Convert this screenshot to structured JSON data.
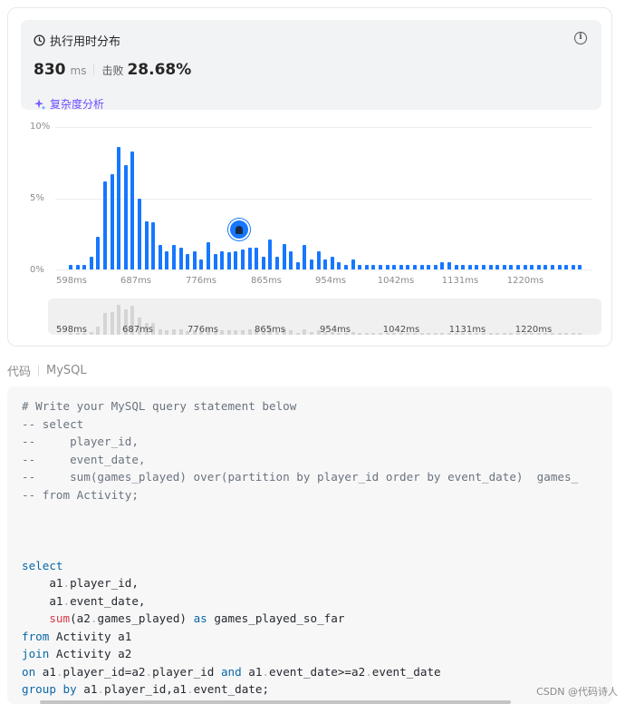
{
  "runtime": {
    "title": "执行用时分布",
    "value": "830",
    "unit": "ms",
    "beat_label": "击败",
    "beat_value": "28.68%",
    "complexity_link": "复杂度分析",
    "info_icon": "i"
  },
  "chart_data": {
    "type": "bar",
    "ylabel": "",
    "xlabel": "",
    "y_ticks": [
      "10%",
      "5%",
      "0%"
    ],
    "ylim": [
      0,
      10
    ],
    "x_ticks": [
      "598ms",
      "687ms",
      "776ms",
      "865ms",
      "954ms",
      "1042ms",
      "1131ms",
      "1220ms"
    ],
    "values": [
      0.3,
      0.3,
      0.3,
      0.9,
      2.3,
      6.2,
      6.7,
      8.6,
      7.3,
      8.3,
      5.0,
      3.4,
      3.3,
      1.7,
      1.3,
      1.7,
      1.5,
      1.1,
      1.3,
      0.7,
      1.9,
      1.1,
      1.3,
      1.2,
      1.3,
      1.4,
      1.5,
      1.5,
      0.9,
      2.1,
      0.9,
      1.8,
      1.3,
      0.5,
      1.7,
      0.7,
      1.3,
      0.7,
      0.9,
      0.5,
      0.3,
      0.7,
      0.3,
      0.3,
      0.3,
      0.3,
      0.3,
      0.3,
      0.3,
      0.3,
      0.3,
      0.3,
      0.3,
      0.3,
      0.5,
      0.5,
      0.3,
      0.3,
      0.3,
      0.3,
      0.3,
      0.3,
      0.3,
      0.3,
      0.3,
      0.3,
      0.3,
      0.3,
      0.3,
      0.3,
      0.3,
      0.3,
      0.3,
      0.3,
      0.3
    ],
    "highlight_bin": 25,
    "grid": true,
    "bar_color": "#1677ff"
  },
  "code_section": {
    "tab_label": "代码",
    "language": "MySQL"
  },
  "code_lines": [
    {
      "t": "# Write your MySQL query statement below",
      "c": "c-comment"
    },
    {
      "t": "-- select",
      "c": "c-comment"
    },
    {
      "t": "--     player_id,",
      "c": "c-comment"
    },
    {
      "t": "--     event_date,",
      "c": "c-comment"
    },
    {
      "t": "--     sum(games_played) over(partition by player_id order by event_date)  games_",
      "c": "c-comment"
    },
    {
      "t": "-- from Activity;",
      "c": "c-comment"
    },
    {
      "t": "",
      "c": "pl"
    },
    {
      "t": "",
      "c": "pl"
    },
    {
      "t": "",
      "c": "pl"
    },
    {
      "t": "select",
      "c": "kw"
    },
    {
      "t": "    a1.player_id,",
      "c": "pl"
    },
    {
      "t": "    a1.event_date,",
      "c": "pl"
    },
    {
      "t": "    sum(a2.games_played) as games_played_so_far",
      "c": "pl"
    },
    {
      "t": "from Activity a1",
      "c": "pl"
    },
    {
      "t": "join Activity a2",
      "c": "pl"
    },
    {
      "t": "on a1.player_id=a2.player_id and a1.event_date>=a2.event_date",
      "c": "pl"
    },
    {
      "t": "group by a1.player_id,a1.event_date;",
      "c": "pl"
    }
  ],
  "watermark": "CSDN @代码诗人",
  "colors": {
    "accent": "#1677ff",
    "complexity": "#6b4dff",
    "keyword": "#0a67a5",
    "function": "#d73a49",
    "comment": "#6a737d"
  }
}
